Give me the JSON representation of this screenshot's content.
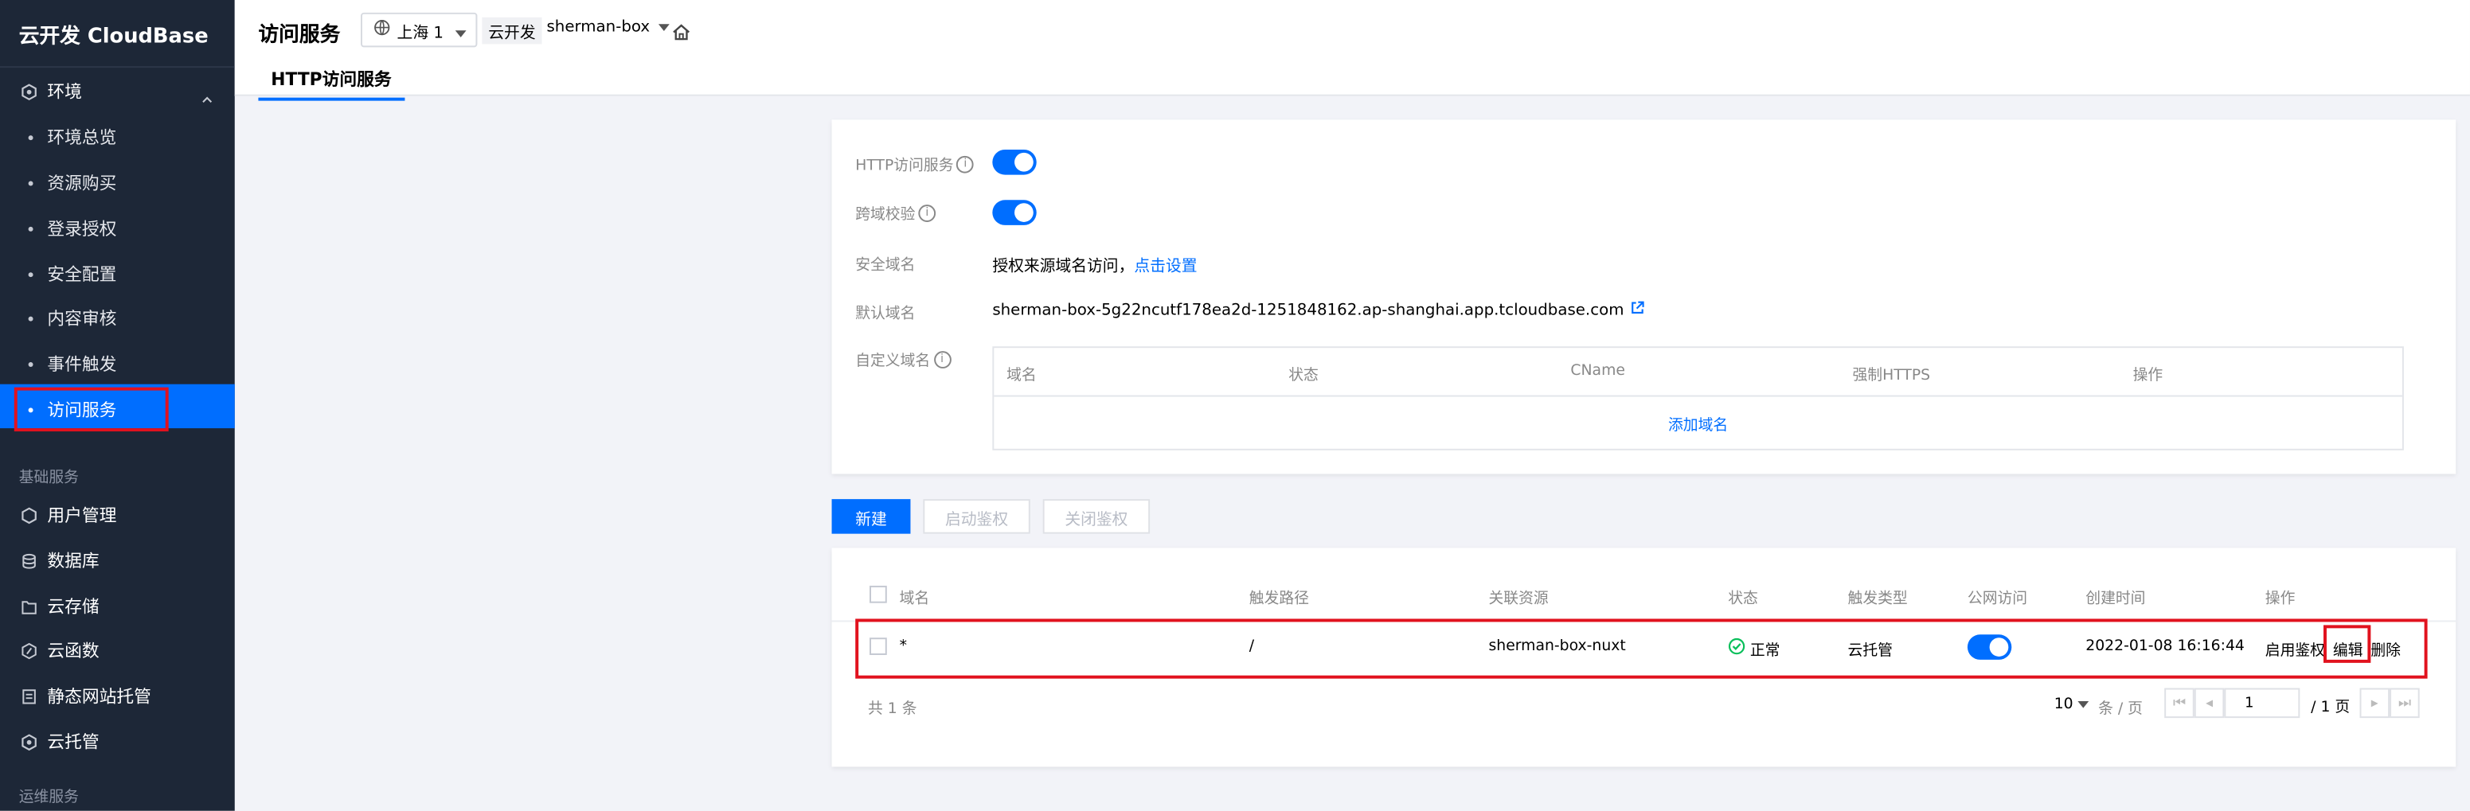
{
  "sidebar": {
    "brand": "云开发 CloudBase",
    "env_group": "环境",
    "env_items": [
      "环境总览",
      "资源购买",
      "登录授权",
      "安全配置",
      "内容审核",
      "事件触发",
      "访问服务"
    ],
    "section_basic": "基础服务",
    "basic_items": [
      "用户管理",
      "数据库",
      "云存储",
      "云函数",
      "静态网站托管",
      "云托管"
    ],
    "section_ops": "运维服务"
  },
  "header": {
    "title": "访问服务",
    "region": "上海 1",
    "crumb": "云开发",
    "env": "sherman-box",
    "tab": "HTTP访问服务"
  },
  "config": {
    "http_label": "HTTP访问服务",
    "cors_label": "跨域校验",
    "safe_domain_label": "安全域名",
    "safe_domain_text": "授权来源域名访问，",
    "safe_domain_link": "点击设置",
    "default_domain_label": "默认域名",
    "default_domain": "sherman-box-5g22ncutf178ea2d-1251848162.ap-shanghai.app.tcloudbase.com",
    "custom_domain_label": "自定义域名",
    "custom_headers": [
      "域名",
      "状态",
      "CName",
      "强制HTTPS",
      "操作"
    ],
    "add_domain": "添加域名"
  },
  "actions": {
    "new": "新建",
    "enable_auth": "启动鉴权",
    "disable_auth": "关闭鉴权"
  },
  "table": {
    "headers": [
      "域名",
      "触发路径",
      "关联资源",
      "状态",
      "触发类型",
      "公网访问",
      "创建时间",
      "操作"
    ],
    "row": {
      "domain": "*",
      "path": "/",
      "resource": "sherman-box-nuxt",
      "status": "正常",
      "type": "云托管",
      "created": "2022-01-08 16:16:44",
      "op_auth": "启用鉴权",
      "op_edit": "编辑",
      "op_delete": "删除"
    },
    "total": "共 1 条",
    "page_size": "10",
    "page_size_unit": "条 / 页",
    "page_current": "1",
    "page_total": "/ 1 页"
  }
}
